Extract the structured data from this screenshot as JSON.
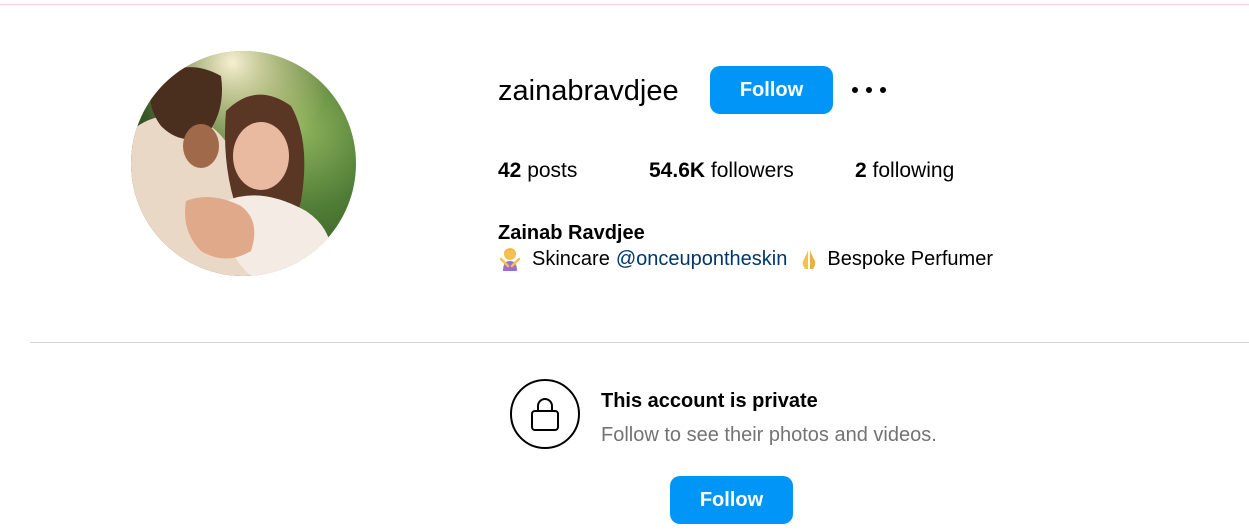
{
  "profile": {
    "username": "zainabravdjee",
    "follow_label": "Follow",
    "more_icon": "more-horizontal-icon",
    "stats": {
      "posts_count": "42",
      "posts_label": "posts",
      "followers_count": "54.6K",
      "followers_label": "followers",
      "following_count": "2",
      "following_label": "following"
    },
    "full_name": "Zainab Ravdjee",
    "bio": {
      "emoji_1": "woman-gesturing-icon",
      "text_1": "Skincare",
      "mention": "@onceupontheskin",
      "emoji_2": "folded-hands-icon",
      "text_2": "Bespoke Perfumer"
    }
  },
  "private_notice": {
    "icon": "lock-icon",
    "title": "This account is private",
    "subtitle": "Follow to see their photos and videos.",
    "follow_label": "Follow"
  },
  "colors": {
    "accent": "#0095f6",
    "mention": "#00376b",
    "muted_text": "#737373",
    "divider": "#d4d4d4"
  }
}
